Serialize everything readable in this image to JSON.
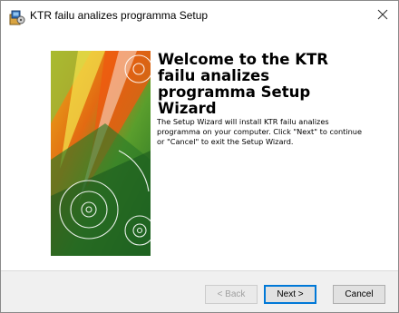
{
  "window": {
    "title": "KTR failu analizes programma Setup"
  },
  "welcome": {
    "heading": "Welcome to the KTR failu analizes programma Setup Wizard",
    "body": "The Setup Wizard will install KTR failu analizes programma on your computer.  Click \"Next\" to continue or \"Cancel\" to exit the Setup Wizard."
  },
  "buttons": {
    "back": "< Back",
    "next": "Next >",
    "cancel": "Cancel"
  },
  "icons": {
    "app": "installer-icon",
    "close": "close-icon",
    "banner": "banner-graphic"
  }
}
